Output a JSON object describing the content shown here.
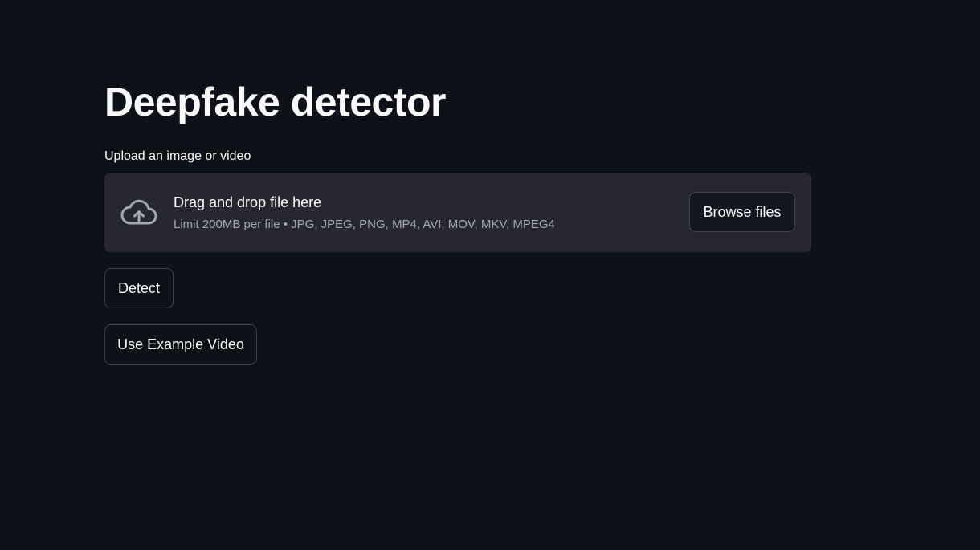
{
  "page": {
    "title": "Deepfake detector"
  },
  "uploader": {
    "label": "Upload an image or video",
    "drop_text": "Drag and drop file here",
    "limit_text": "Limit 200MB per file • JPG, JPEG, PNG, MP4, AVI, MOV, MKV, MPEG4",
    "browse_label": "Browse files",
    "icon": "cloud-upload-icon"
  },
  "actions": {
    "detect_label": "Detect",
    "example_label": "Use Example Video"
  },
  "colors": {
    "background": "#0e1117",
    "dropzone": "#262730",
    "text": "#fafafa",
    "muted_text": "#a3a8b4"
  }
}
